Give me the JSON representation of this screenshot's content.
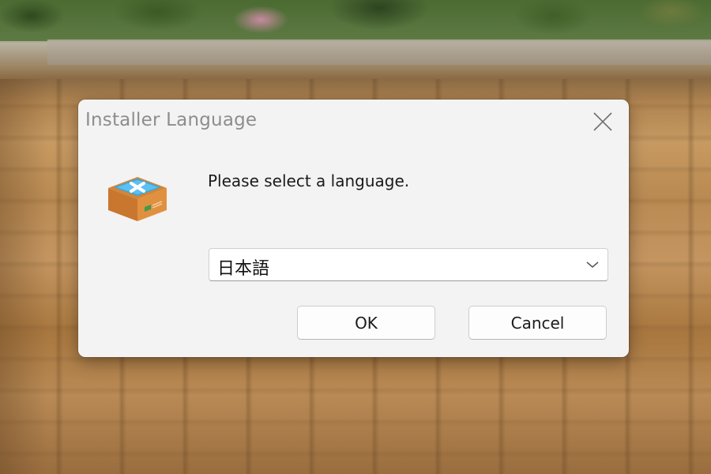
{
  "dialog": {
    "title": "Installer Language",
    "prompt": "Please select a language.",
    "language_select": {
      "value": "日本語"
    },
    "buttons": {
      "ok_label": "OK",
      "cancel_label": "Cancel"
    },
    "icons": {
      "close": "close-icon",
      "app": "installer-box-icon",
      "dropdown": "chevron-down-icon"
    }
  },
  "colors": {
    "dialog_background": "#f3f3f3",
    "title_text": "#8d8d8d",
    "box_orange": "#d98b3c",
    "box_top_blue": "#3aa7e3"
  }
}
